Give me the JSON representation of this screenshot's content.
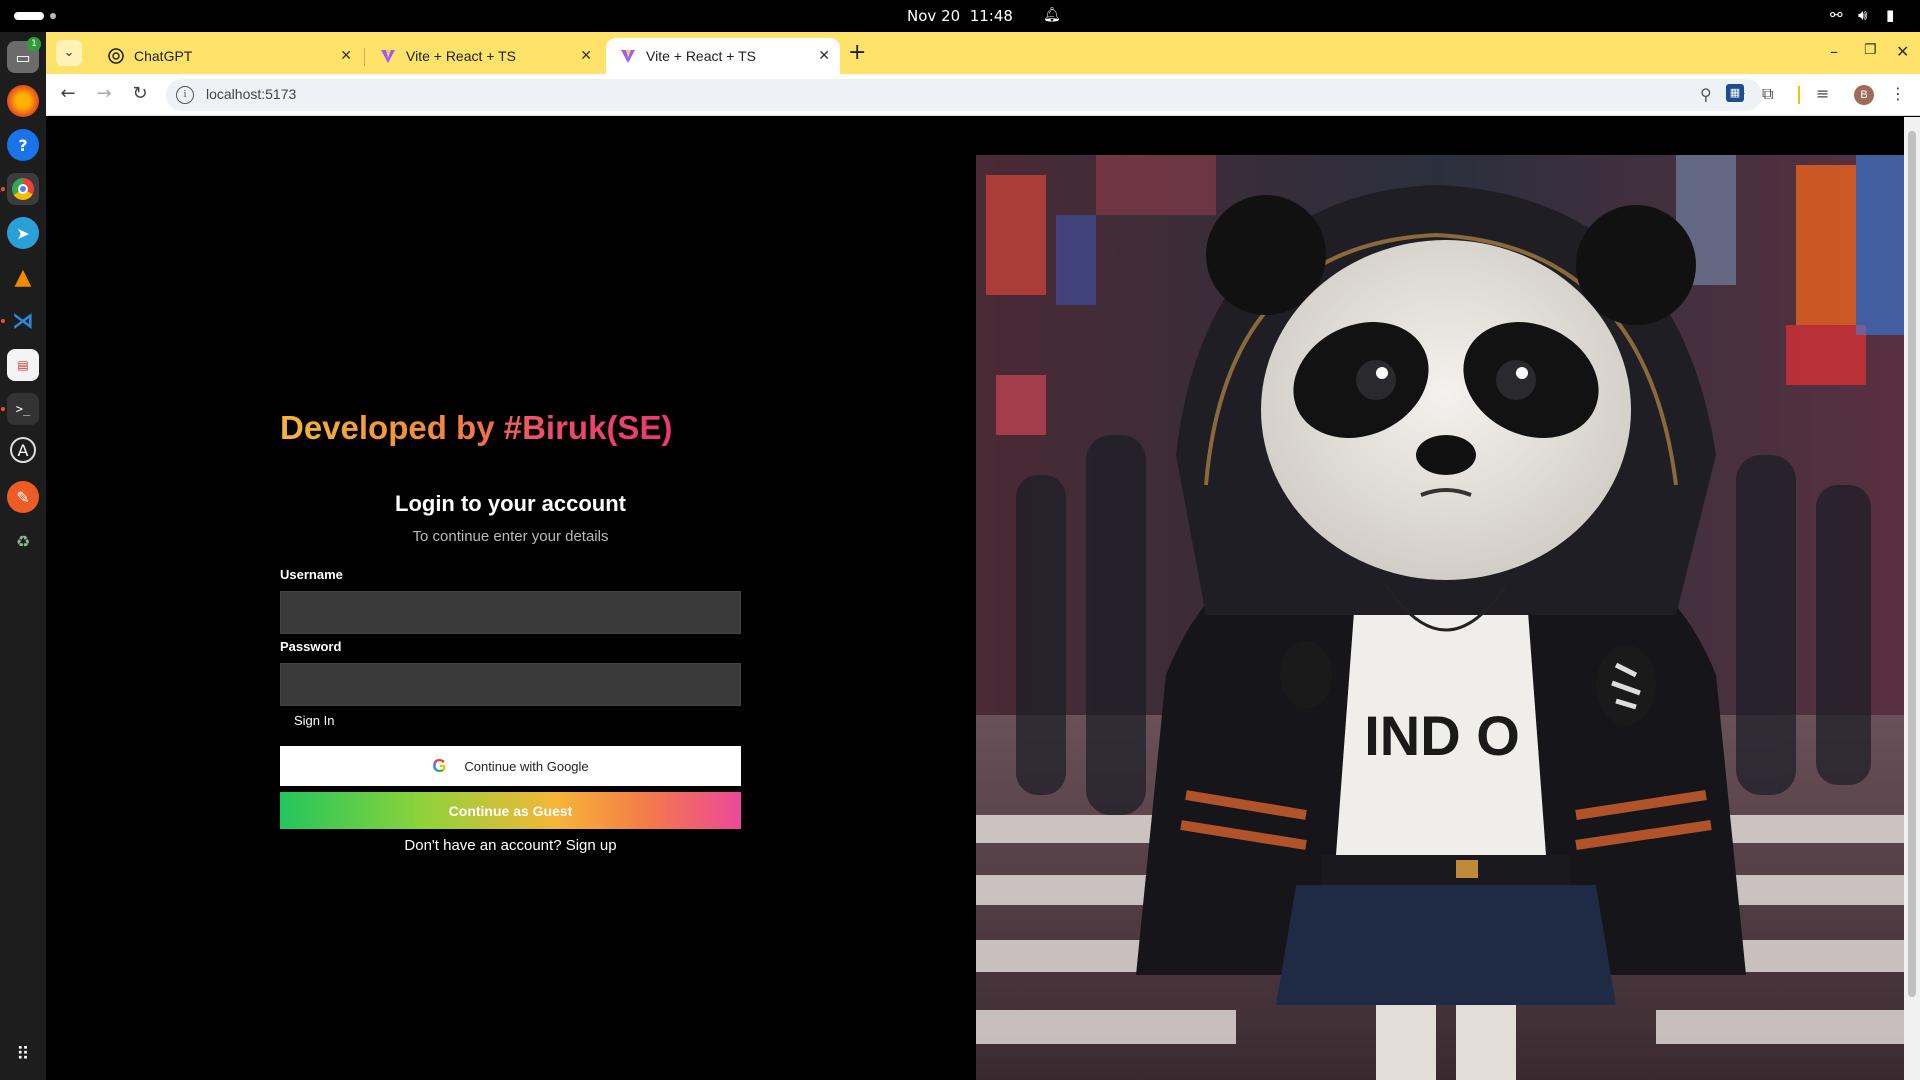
{
  "system": {
    "date": "Nov 20",
    "time": "11:48"
  },
  "dock": {
    "files_badge": "1",
    "items": [
      "files-icon",
      "firefox-icon",
      "help-icon",
      "chrome-icon",
      "telegram-icon",
      "vlc-icon",
      "vscode-icon",
      "document-viewer-icon",
      "terminal-icon",
      "software-updater-icon",
      "postman-icon",
      "trash-icon"
    ]
  },
  "browser": {
    "tabs": [
      {
        "title": "ChatGPT",
        "favicon": "openai-icon"
      },
      {
        "title": "Vite + React + TS",
        "favicon": "vite-icon"
      },
      {
        "title": "Vite + React + TS",
        "favicon": "vite-icon",
        "active": true
      }
    ],
    "url": "localhost:5173",
    "profile_initial": "B",
    "tabbar_color": "#ffe26a"
  },
  "page": {
    "brand": "Developed by #Biruk(SE)",
    "login_title": "Login to your account",
    "login_subtitle": "To continue enter your details",
    "username_label": "Username",
    "username_value": "",
    "password_label": "Password",
    "password_value": "",
    "signin_label": "Sign In",
    "google_label": "Continue with Google",
    "guest_label": "Continue as Guest",
    "signup_prefix": "Don't have an account?",
    "signup_link": "Sign up",
    "hero_image": "panda-in-hoodie-city-street",
    "hero_text": "IND O"
  }
}
